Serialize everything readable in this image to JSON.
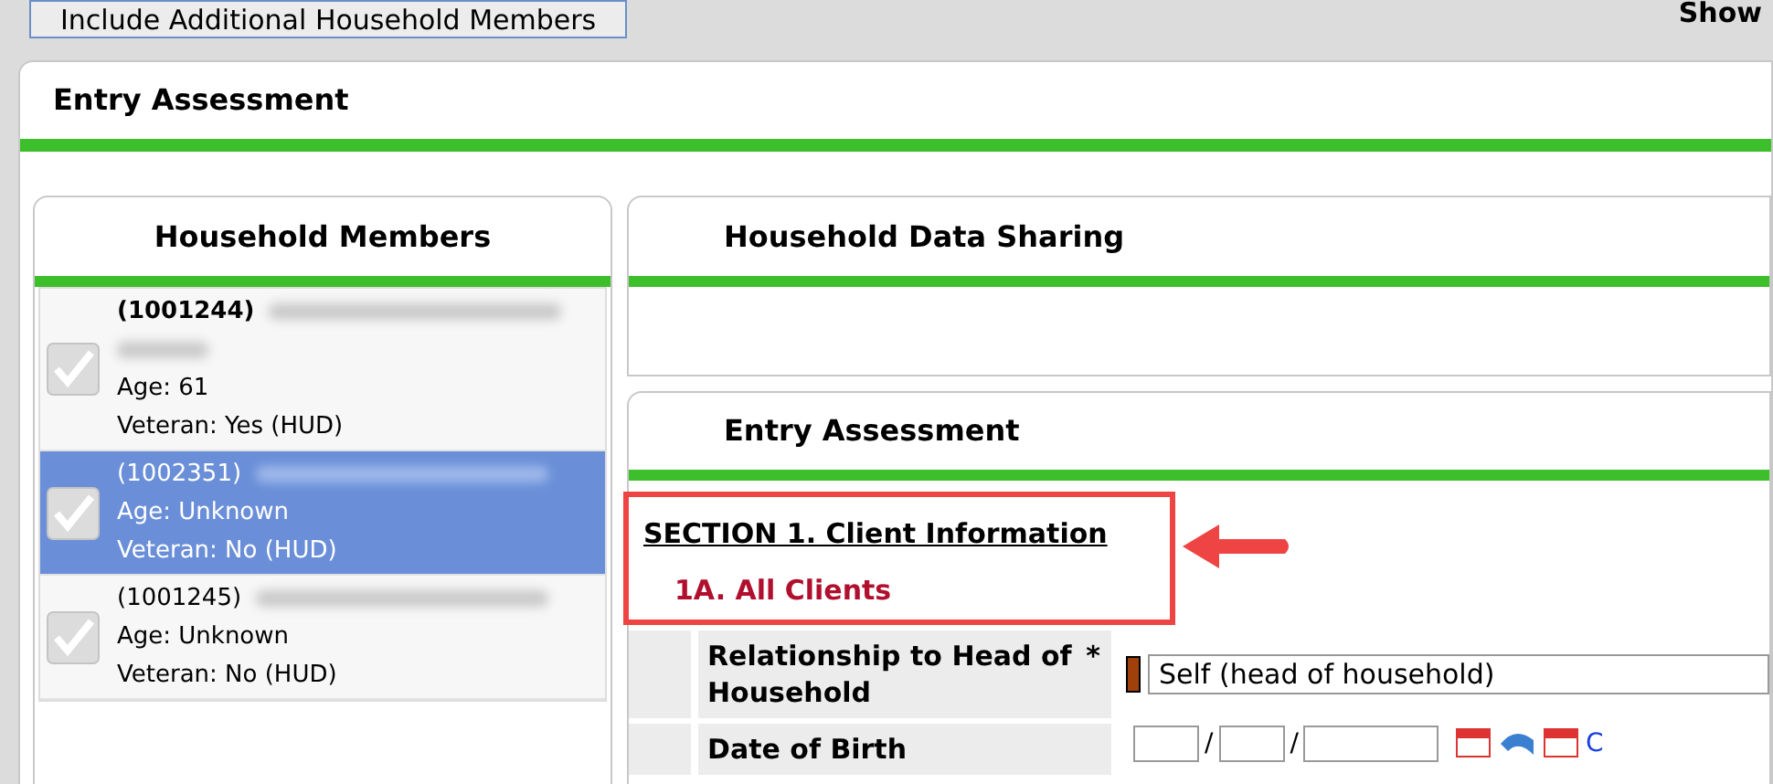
{
  "toolbar": {
    "button": "Include Additional Household Members",
    "right_label": "Show"
  },
  "panel": {
    "title": "Entry Assessment"
  },
  "household": {
    "title": "Household Members",
    "members": [
      {
        "id": "(1001244)",
        "age": "Age: 61",
        "veteran": "Veteran: Yes (HUD)",
        "selected": false,
        "checked": true,
        "current": true
      },
      {
        "id": "(1002351)",
        "age": "Age: Unknown",
        "veteran": "Veteran: No (HUD)",
        "selected": true,
        "checked": true,
        "current": false
      },
      {
        "id": "(1001245)",
        "age": "Age: Unknown",
        "veteran": "Veteran: No (HUD)",
        "selected": false,
        "checked": true,
        "current": false
      }
    ]
  },
  "data_sharing": {
    "title": "Household Data Sharing"
  },
  "assessment": {
    "title": "Entry Assessment",
    "section": "SECTION 1. Client Information",
    "subsection": "1A. All Clients",
    "fields": [
      {
        "kind": "select",
        "label": "Relationship to Head of Household",
        "required": "*",
        "value": "Self (head of household)"
      },
      {
        "kind": "date",
        "label": "Date of Birth",
        "separators": [
          "/",
          "/"
        ],
        "link": "C"
      }
    ]
  }
}
